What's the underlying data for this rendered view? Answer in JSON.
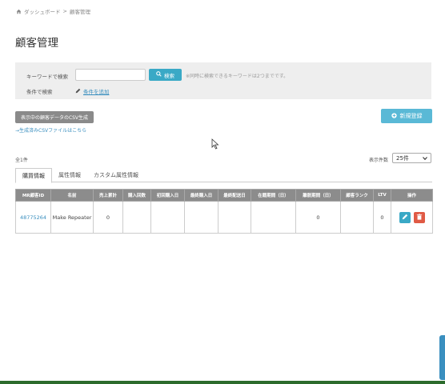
{
  "breadcrumb": {
    "home": "ダッシュボード",
    "separator": ">",
    "current": "顧客管理"
  },
  "page_title": "顧客管理",
  "search": {
    "keyword_label": "キーワードで検索",
    "keyword_value": "",
    "search_button": "検索",
    "hint": "※同時に検索できるキーワードは2つまでです。",
    "condition_label": "条件で検索",
    "condition_link": "条件を追加"
  },
  "actions": {
    "csv_button": "表示中の顧客データのCSV生成",
    "csv_link": "→生成済みCSVファイルはこちら",
    "new_button": "新規登録"
  },
  "list": {
    "total": "全1件",
    "per_page_label": "表示件数",
    "per_page_value": "25件"
  },
  "tabs": [
    {
      "label": "購買情報",
      "active": true
    },
    {
      "label": "属性情報",
      "active": false
    },
    {
      "label": "カスタム属性情報",
      "active": false
    }
  ],
  "table": {
    "columns": [
      "MR顧客ID",
      "名前",
      "売上累計",
      "購入回数",
      "初回購入日",
      "最終購入日",
      "最終配送日",
      "在籍期間（日）",
      "離脱期間（日）",
      "顧客ランク",
      "LTV",
      "操作"
    ],
    "rows": [
      [
        "48775264",
        "Make Repeater",
        "0",
        "",
        "",
        "",
        "",
        "",
        "0",
        "",
        "0",
        ""
      ]
    ]
  },
  "colors": {
    "accent": "#3aa9c6",
    "header_bg": "#8c8c8c",
    "delete": "#e05a45",
    "link": "#3a8fbf"
  }
}
